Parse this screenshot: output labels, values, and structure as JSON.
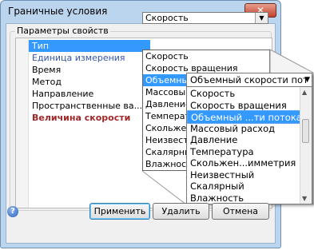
{
  "window": {
    "title": "Граничные условия",
    "close_glyph": "✕"
  },
  "group": {
    "label": "Параметры свойств"
  },
  "properties": [
    {
      "label": "Тип"
    },
    {
      "label": "Единица измерения"
    },
    {
      "label": "Время"
    },
    {
      "label": "Метод"
    },
    {
      "label": "Направление"
    },
    {
      "label": "Пространственные ва..."
    },
    {
      "label": "Величина скорости"
    }
  ],
  "type_combo": {
    "value": "Скорость"
  },
  "dropdown_items": [
    "Скорость",
    "Скорость вращения",
    "Объемный ...",
    "Массовый ра...",
    "Давление",
    "Температ...",
    "Скольжен...",
    "Неизвест...",
    "Скалярны...",
    "Влажност..."
  ],
  "zoom_callout": {
    "combo_value": "Объемный скорости пот",
    "items": [
      "Скорость",
      "Скорость вращения",
      "Объемный ...ти потока",
      "Массовый расход",
      "Давление",
      "Температура",
      "Скольжен...имметрия",
      "Неизвестный",
      "Скалярный",
      "Влажность"
    ]
  },
  "buttons": {
    "apply": "Применить",
    "delete": "Удалить",
    "cancel": "Отмена"
  },
  "colors": {
    "selection": "#3399ff",
    "blue_label": "#3355aa",
    "red_label": "#a0282a",
    "frame": "#bcd5ee"
  }
}
